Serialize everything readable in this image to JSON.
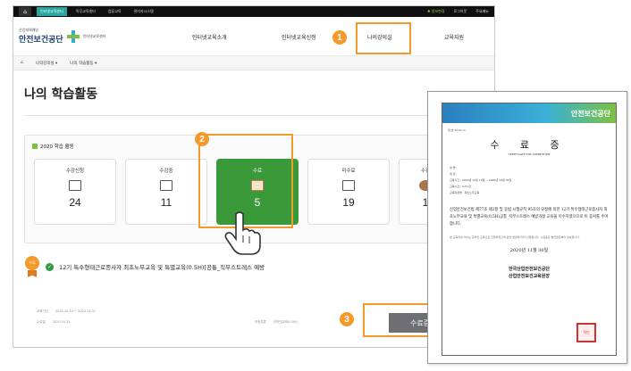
{
  "topbar": {
    "items": [
      "인터넷교육센터",
      "직무교육센터",
      "컴퓨교육",
      "관리자시스템"
    ],
    "right": [
      "♣ 정보변경",
      "로그아웃",
      "주요메뉴"
    ]
  },
  "header": {
    "logo_small": "산업재해예방",
    "logo_name": "안전보건공단",
    "logo_center": "인터넷교육센터",
    "nav": [
      "인터넷교육소개",
      "인터넷교육신청",
      "나의강의실",
      "교육지원"
    ]
  },
  "breadcrumb": {
    "home_icon": "home-icon",
    "level1": "나의강의실",
    "level2": "나의 학습활동"
  },
  "page_title": "나의 학습활동",
  "panel": {
    "title": "2020 학습 활동",
    "cards": [
      {
        "label": "수강신청",
        "value": "24",
        "icon": "write-icon"
      },
      {
        "label": "수강중",
        "value": "11",
        "icon": "monitor-icon"
      },
      {
        "label": "수료",
        "value": "5",
        "icon": "certificate-icon"
      },
      {
        "label": "미수료",
        "value": "19",
        "icon": "clipboard-icon"
      },
      {
        "label": "수강",
        "value": "1",
        "icon": "person-icon"
      }
    ]
  },
  "course": {
    "medal_text": "수료",
    "title": "12기 특수형태근로종사자 최초노무교육 및 특별교육(0.5H)[공통_직무스트레스 예방",
    "meta_left": [
      "교육기간",
      "2020.10.14 ~ 2020.12.31",
      "수료일",
      "2020.10.21"
    ],
    "meta_right": [
      "과정분류",
      "인터넷교육(0.5H)"
    ],
    "certificate_button": "수료증"
  },
  "callouts": [
    "1",
    "2",
    "3"
  ],
  "certificate": {
    "org": "안전보건공단",
    "number": "제 호 2020-11",
    "title": "수 료 증",
    "subtitle": "CERTIFICATE FOR COMPLETION",
    "fields": [
      "성 명 :",
      "생 년 :",
      "교육기간 : 2020년 10월 14일 ~ 2020년 12월 31일",
      "교육시간 : 0.5시간",
      "교육과정명 : 최초노무교육"
    ],
    "body": "산업안전보건법 제77조 제2항 및 동법 시행규칙 95조의 규정에 의한 12기 특수형태근로종사자 최초노무교육 및 특별교육(0.5H)공통_직무스트레스 예방과정 교육을 이수하였으므로 이 증서를 수여합니다.",
    "notes": "본 교육과정 이수는 온라인 교육으로 진행되었으며 관련 법령에 따라 인정됩니다. 수료증은 발급일로부터 유효합니다.",
    "date": "2020년 11월 30일",
    "issuer": [
      "한국산업안전보건공단",
      "산업안전보건교육원장"
    ],
    "seal": "직인"
  }
}
